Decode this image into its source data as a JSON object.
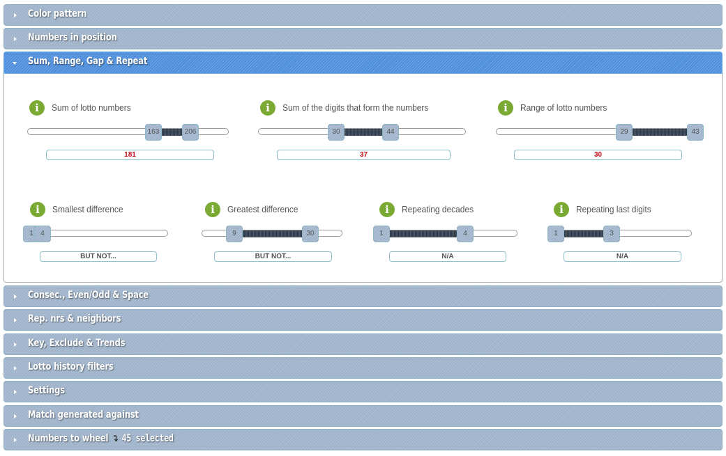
{
  "sections": [
    {
      "title": "Color pattern",
      "open": false
    },
    {
      "title": "Numbers in position",
      "open": false
    },
    {
      "title": "Sum, Range, Gap & Repeat",
      "open": true
    },
    {
      "title": "Consec., Even/Odd & Space",
      "open": false
    },
    {
      "title": "Rep. nrs & neighbors",
      "open": false
    },
    {
      "title": "Key, Exclude & Trends",
      "open": false
    },
    {
      "title": "Lotto history filters",
      "open": false
    },
    {
      "title": "Settings",
      "open": false
    },
    {
      "title": "Match generated against",
      "open": false
    },
    {
      "title": "Numbers to wheel",
      "open": false,
      "selected_text": "45 selected"
    }
  ],
  "filters": {
    "sum": {
      "label": "Sum of lotto numbers",
      "low": "163",
      "high": "206",
      "value": "181",
      "icon": "info-icon"
    },
    "digits": {
      "label": "Sum of the digits that form the numbers",
      "low": "30",
      "high": "44",
      "value": "37",
      "icon": "info-icon"
    },
    "range": {
      "label": "Range of lotto numbers",
      "low": "29",
      "high": "43",
      "value": "30",
      "icon": "info-icon"
    },
    "smallest": {
      "label": "Smallest difference",
      "low": "1",
      "high": "4",
      "value": "BUT NOT...",
      "icon": "info-icon"
    },
    "greatest": {
      "label": "Greatest difference",
      "low": "9",
      "high": "30",
      "value": "BUT NOT...",
      "icon": "info-icon"
    },
    "decades": {
      "label": "Repeating decades",
      "low": "1",
      "high": "4",
      "value": "N/A",
      "icon": "info-icon"
    },
    "lastdigits": {
      "label": "Repeating last digits",
      "low": "1",
      "high": "3",
      "value": "N/A",
      "icon": "info-icon"
    }
  },
  "info_glyph": "i",
  "colors": {
    "open_header": "#4e8fdc",
    "closed_header": "#9fb3ca",
    "info_green": "#7aaa34",
    "value_red": "#c0101a"
  }
}
